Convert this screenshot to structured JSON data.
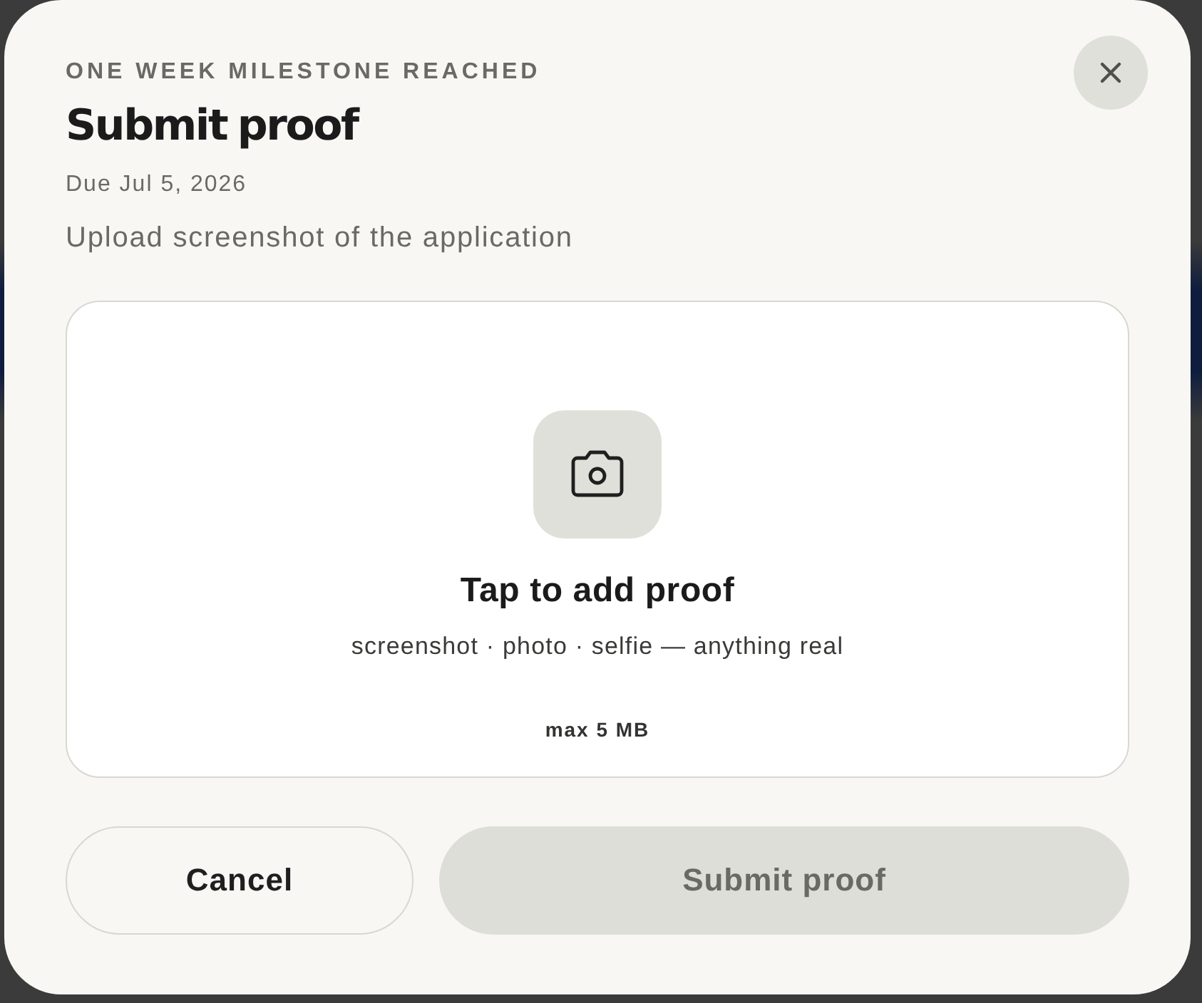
{
  "dialog": {
    "eyebrow": "ONE WEEK MILESTONE REACHED",
    "title": "Submit proof",
    "due": "Due Jul 5, 2026",
    "instructions": "Upload screenshot of the application"
  },
  "upload": {
    "title": "Tap to add proof",
    "hint": "screenshot · photo · selfie — anything real",
    "limit": "max 5 MB"
  },
  "buttons": [
    {
      "label": "Cancel",
      "kind": "secondary",
      "disabled": false
    },
    {
      "label": "Submit proof",
      "kind": "primary",
      "disabled": true
    }
  ]
}
